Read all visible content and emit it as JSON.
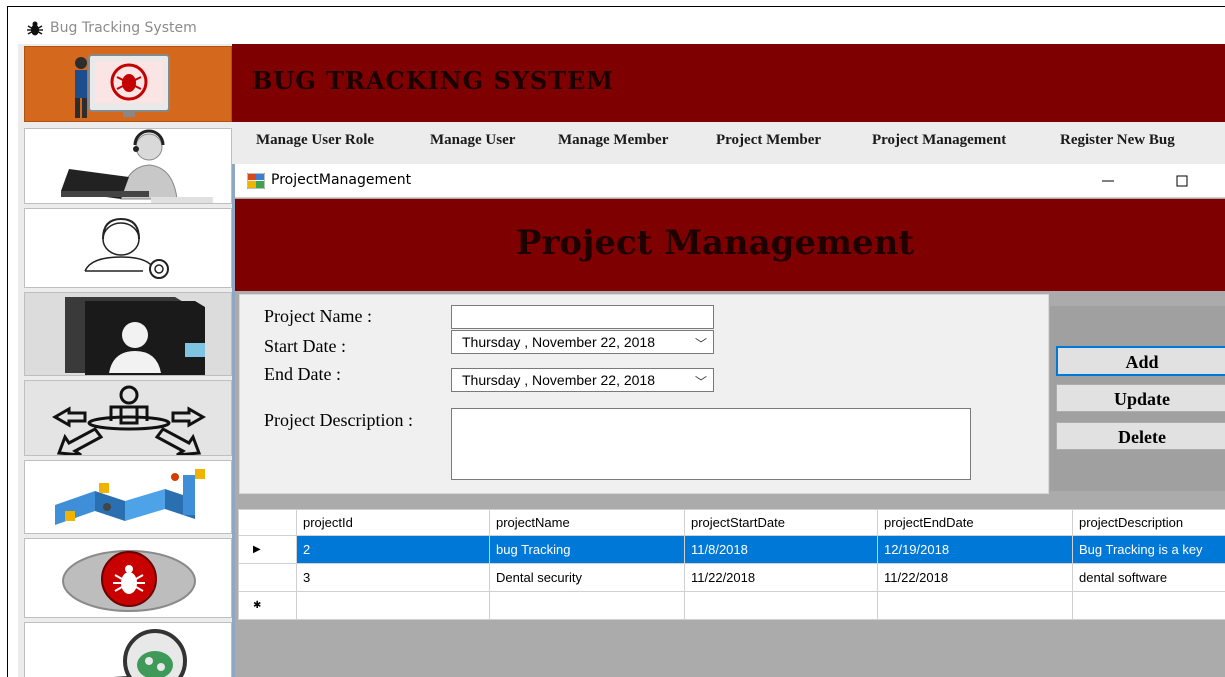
{
  "app": {
    "title": "Bug Tracking System",
    "banner_title": "BUG TRACKING SYSTEM"
  },
  "menu": {
    "items": [
      {
        "label": "Manage User Role"
      },
      {
        "label": "Manage User"
      },
      {
        "label": "Manage Member"
      },
      {
        "label": "Project  Member"
      },
      {
        "label": "Project Management"
      },
      {
        "label": "Register New Bug"
      }
    ]
  },
  "child_window": {
    "title": "ProjectManagement",
    "minimize_glyph": "—",
    "maximize_glyph": "☐"
  },
  "page": {
    "heading": "Project Management"
  },
  "form": {
    "project_name_label": "Project Name :",
    "project_name_value": "",
    "start_date_label": "Start Date :",
    "start_date_value": "Thursday  , November 22, 2018",
    "end_date_label": "End Date :",
    "end_date_value": "Thursday  , November 22, 2018",
    "description_label": "Project Description :",
    "description_value": "",
    "dropdown_glyph": "﹀"
  },
  "actions": {
    "add_label": "Add",
    "update_label": "Update",
    "delete_label": "Delete"
  },
  "grid": {
    "columns": [
      "projectId",
      "projectName",
      "projectStartDate",
      "projectEndDate",
      "projectDescription"
    ],
    "rows": [
      {
        "marker": "▶",
        "projectId": "2",
        "projectName": "bug Tracking",
        "projectStartDate": "11/8/2018",
        "projectEndDate": "12/19/2018",
        "projectDescription": "Bug Tracking is a key"
      },
      {
        "marker": "",
        "projectId": "3",
        "projectName": "Dental security",
        "projectStartDate": "11/22/2018",
        "projectEndDate": "11/22/2018",
        "projectDescription": "dental software"
      },
      {
        "marker": "✱",
        "projectId": "",
        "projectName": "",
        "projectStartDate": "",
        "projectEndDate": "",
        "projectDescription": ""
      }
    ],
    "selected_row": 0
  },
  "sidebar": {
    "items": [
      {
        "icon": "support-agent-icon"
      },
      {
        "icon": "user-settings-icon"
      },
      {
        "icon": "user-folder-icon"
      },
      {
        "icon": "user-network-icon"
      },
      {
        "icon": "workflow-icon"
      },
      {
        "icon": "bug-button-icon"
      },
      {
        "icon": "bug-search-icon"
      }
    ]
  },
  "colors": {
    "banner": "#7f0000",
    "selection": "#0078d7",
    "logo_tile": "#d4691e"
  }
}
